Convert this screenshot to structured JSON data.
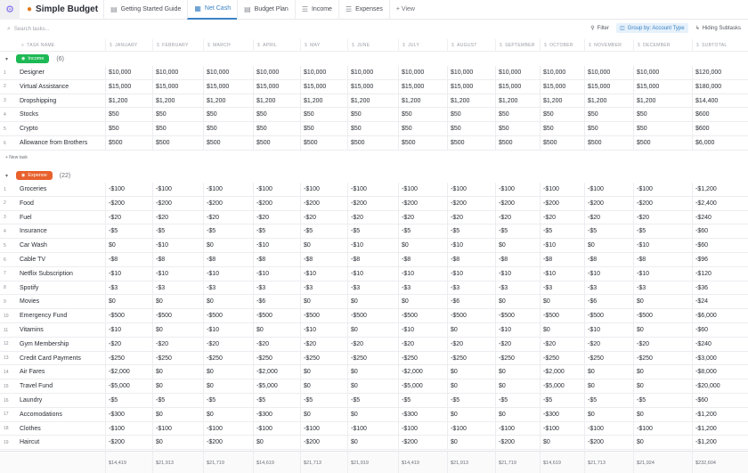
{
  "app": {
    "title": "Simple Budget",
    "logo_icon": "settings-gear-icon",
    "title_icon": "money-bag-icon"
  },
  "tabs": [
    {
      "label": "Getting Started Guide",
      "icon": "doc-icon",
      "active": false
    },
    {
      "label": "Net Cash",
      "icon": "table-icon",
      "active": true
    },
    {
      "label": "Budget Plan",
      "icon": "doc-icon",
      "active": false
    },
    {
      "label": "Income",
      "icon": "list-icon",
      "active": false
    },
    {
      "label": "Expenses",
      "icon": "list-icon",
      "active": false
    }
  ],
  "add_view_label": "+ View",
  "toolbar": {
    "search_placeholder": "Search tasks...",
    "filter_label": "Filter",
    "group_label": "Group by: Account Type",
    "subtasks_label": "Hiding Subtasks"
  },
  "columns": [
    "TASK NAME",
    "JANUARY",
    "FEBRUARY",
    "MARCH",
    "APRIL",
    "MAY",
    "JUNE",
    "JULY",
    "AUGUST",
    "SEPTEMBER",
    "OCTOBER",
    "NOVEMBER",
    "DECEMBER",
    "SUBTOTAL"
  ],
  "groups": [
    {
      "label": "Income",
      "count": "(6)",
      "color": "#1db954",
      "new_task_label": "+ New task",
      "rows": [
        {
          "num": "1",
          "name": "Designer",
          "values": [
            "$10,000",
            "$10,000",
            "$10,000",
            "$10,000",
            "$10,000",
            "$10,000",
            "$10,000",
            "$10,000",
            "$10,000",
            "$10,000",
            "$10,000",
            "$10,000",
            "$120,000"
          ]
        },
        {
          "num": "2",
          "name": "Virtual Assistance",
          "values": [
            "$15,000",
            "$15,000",
            "$15,000",
            "$15,000",
            "$15,000",
            "$15,000",
            "$15,000",
            "$15,000",
            "$15,000",
            "$15,000",
            "$15,000",
            "$15,000",
            "$180,000"
          ]
        },
        {
          "num": "3",
          "name": "Dropshipping",
          "values": [
            "$1,200",
            "$1,200",
            "$1,200",
            "$1,200",
            "$1,200",
            "$1,200",
            "$1,200",
            "$1,200",
            "$1,200",
            "$1,200",
            "$1,200",
            "$1,200",
            "$14,400"
          ]
        },
        {
          "num": "4",
          "name": "Stocks",
          "values": [
            "$50",
            "$50",
            "$50",
            "$50",
            "$50",
            "$50",
            "$50",
            "$50",
            "$50",
            "$50",
            "$50",
            "$50",
            "$600"
          ]
        },
        {
          "num": "5",
          "name": "Crypto",
          "values": [
            "$50",
            "$50",
            "$50",
            "$50",
            "$50",
            "$50",
            "$50",
            "$50",
            "$50",
            "$50",
            "$50",
            "$50",
            "$600"
          ]
        },
        {
          "num": "6",
          "name": "Allowance from Brothers",
          "values": [
            "$500",
            "$500",
            "$500",
            "$500",
            "$500",
            "$500",
            "$500",
            "$500",
            "$500",
            "$500",
            "$500",
            "$500",
            "$6,000"
          ]
        }
      ]
    },
    {
      "label": "Expense",
      "count": "(22)",
      "color": "#e8612c",
      "rows": [
        {
          "num": "1",
          "name": "Groceries",
          "values": [
            "-$100",
            "-$100",
            "-$100",
            "-$100",
            "-$100",
            "-$100",
            "-$100",
            "-$100",
            "-$100",
            "-$100",
            "-$100",
            "-$100",
            "-$1,200"
          ]
        },
        {
          "num": "2",
          "name": "Food",
          "values": [
            "-$200",
            "-$200",
            "-$200",
            "-$200",
            "-$200",
            "-$200",
            "-$200",
            "-$200",
            "-$200",
            "-$200",
            "-$200",
            "-$200",
            "-$2,400"
          ]
        },
        {
          "num": "3",
          "name": "Fuel",
          "values": [
            "-$20",
            "-$20",
            "-$20",
            "-$20",
            "-$20",
            "-$20",
            "-$20",
            "-$20",
            "-$20",
            "-$20",
            "-$20",
            "-$20",
            "-$240"
          ]
        },
        {
          "num": "4",
          "name": "Insurance",
          "values": [
            "-$5",
            "-$5",
            "-$5",
            "-$5",
            "-$5",
            "-$5",
            "-$5",
            "-$5",
            "-$5",
            "-$5",
            "-$5",
            "-$5",
            "-$60"
          ]
        },
        {
          "num": "5",
          "name": "Car Wash",
          "values": [
            "$0",
            "-$10",
            "$0",
            "-$10",
            "$0",
            "-$10",
            "$0",
            "-$10",
            "$0",
            "-$10",
            "$0",
            "-$10",
            "-$60"
          ]
        },
        {
          "num": "6",
          "name": "Cable TV",
          "values": [
            "-$8",
            "-$8",
            "-$8",
            "-$8",
            "-$8",
            "-$8",
            "-$8",
            "-$8",
            "-$8",
            "-$8",
            "-$8",
            "-$8",
            "-$96"
          ]
        },
        {
          "num": "7",
          "name": "Netflix Subscription",
          "values": [
            "-$10",
            "-$10",
            "-$10",
            "-$10",
            "-$10",
            "-$10",
            "-$10",
            "-$10",
            "-$10",
            "-$10",
            "-$10",
            "-$10",
            "-$120"
          ]
        },
        {
          "num": "8",
          "name": "Spotify",
          "values": [
            "-$3",
            "-$3",
            "-$3",
            "-$3",
            "-$3",
            "-$3",
            "-$3",
            "-$3",
            "-$3",
            "-$3",
            "-$3",
            "-$3",
            "-$36"
          ]
        },
        {
          "num": "9",
          "name": "Movies",
          "values": [
            "$0",
            "$0",
            "$0",
            "-$6",
            "$0",
            "$0",
            "$0",
            "-$6",
            "$0",
            "$0",
            "-$6",
            "$0",
            "-$24"
          ]
        },
        {
          "num": "10",
          "name": "Emergency Fund",
          "values": [
            "-$500",
            "-$500",
            "-$500",
            "-$500",
            "-$500",
            "-$500",
            "-$500",
            "-$500",
            "-$500",
            "-$500",
            "-$500",
            "-$500",
            "-$6,000"
          ]
        },
        {
          "num": "11",
          "name": "Vitamins",
          "values": [
            "-$10",
            "$0",
            "-$10",
            "$0",
            "-$10",
            "$0",
            "-$10",
            "$0",
            "-$10",
            "$0",
            "-$10",
            "$0",
            "-$60"
          ]
        },
        {
          "num": "12",
          "name": "Gym Membership",
          "values": [
            "-$20",
            "-$20",
            "-$20",
            "-$20",
            "-$20",
            "-$20",
            "-$20",
            "-$20",
            "-$20",
            "-$20",
            "-$20",
            "-$20",
            "-$240"
          ]
        },
        {
          "num": "13",
          "name": "Credit Card Payments",
          "values": [
            "-$250",
            "-$250",
            "-$250",
            "-$250",
            "-$250",
            "-$250",
            "-$250",
            "-$250",
            "-$250",
            "-$250",
            "-$250",
            "-$250",
            "-$3,000"
          ]
        },
        {
          "num": "14",
          "name": "Air Fares",
          "values": [
            "-$2,000",
            "$0",
            "$0",
            "-$2,000",
            "$0",
            "$0",
            "-$2,000",
            "$0",
            "$0",
            "-$2,000",
            "$0",
            "$0",
            "-$8,000"
          ]
        },
        {
          "num": "15",
          "name": "Travel Fund",
          "values": [
            "-$5,000",
            "$0",
            "$0",
            "-$5,000",
            "$0",
            "$0",
            "-$5,000",
            "$0",
            "$0",
            "-$5,000",
            "$0",
            "$0",
            "-$20,000"
          ]
        },
        {
          "num": "16",
          "name": "Laundry",
          "values": [
            "-$5",
            "-$5",
            "-$5",
            "-$5",
            "-$5",
            "-$5",
            "-$5",
            "-$5",
            "-$5",
            "-$5",
            "-$5",
            "-$5",
            "-$60"
          ]
        },
        {
          "num": "17",
          "name": "Accomodations",
          "values": [
            "-$300",
            "$0",
            "$0",
            "-$300",
            "$0",
            "$0",
            "-$300",
            "$0",
            "$0",
            "-$300",
            "$0",
            "$0",
            "-$1,200"
          ]
        },
        {
          "num": "18",
          "name": "Clothes",
          "values": [
            "-$100",
            "-$100",
            "-$100",
            "-$100",
            "-$100",
            "-$100",
            "-$100",
            "-$100",
            "-$100",
            "-$100",
            "-$100",
            "-$100",
            "-$1,200"
          ]
        },
        {
          "num": "19",
          "name": "Haircut",
          "values": [
            "-$200",
            "$0",
            "-$200",
            "$0",
            "-$200",
            "$0",
            "-$200",
            "$0",
            "-$200",
            "$0",
            "-$200",
            "$0",
            "-$1,200"
          ]
        }
      ]
    }
  ],
  "totals": [
    "$14,419",
    "$21,913",
    "$21,719",
    "$14,619",
    "$21,713",
    "$21,919",
    "$14,419",
    "$21,913",
    "$21,719",
    "$14,619",
    "$21,713",
    "$21,924",
    "$232,604"
  ]
}
